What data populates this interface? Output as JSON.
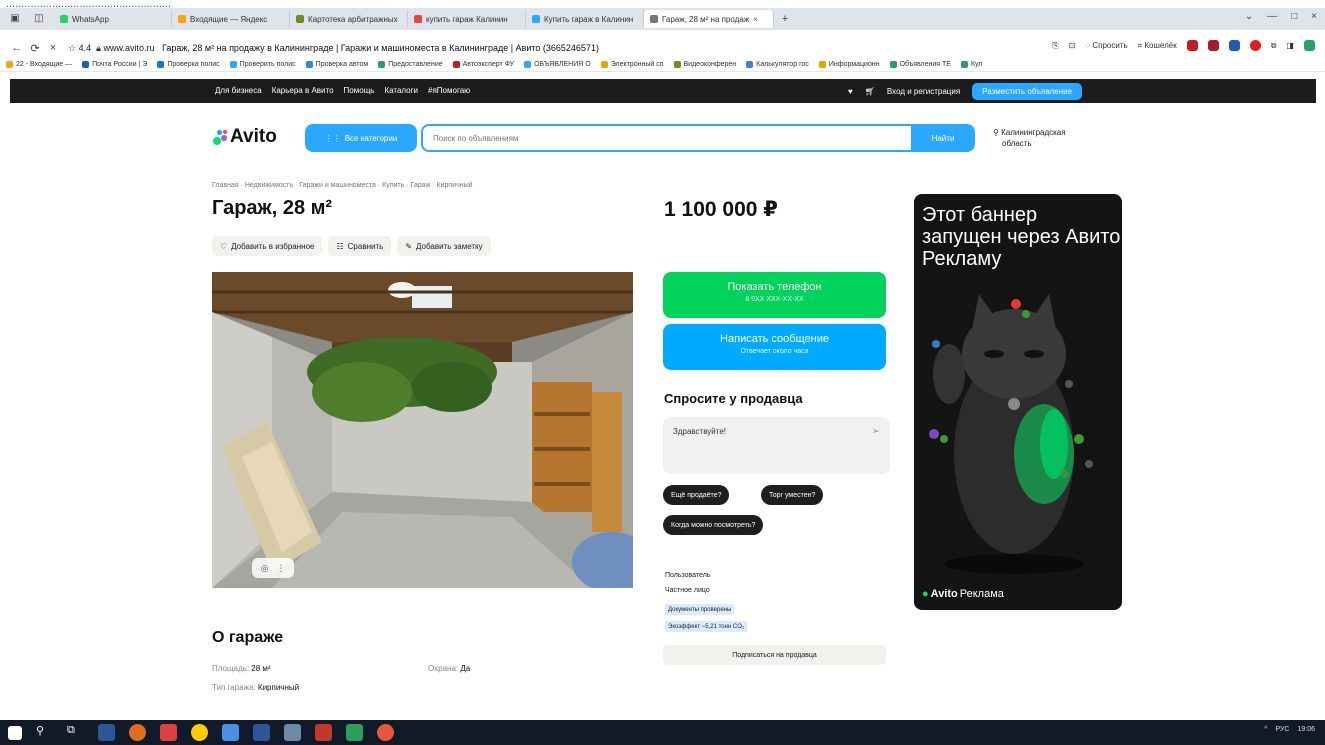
{
  "top_link": "......................................................",
  "browser": {
    "tabs": [
      {
        "label": "WhatsApp",
        "color": "#25d366",
        "active": false
      },
      {
        "label": "Входящие — Яндекс",
        "color": "#f7a21b",
        "active": false
      },
      {
        "label": "Картотека арбитражных",
        "color": "#6b8e23",
        "active": false
      },
      {
        "label": "купить гараж Калинин",
        "color": "#e24a3b",
        "active": false
      },
      {
        "label": "Купить гараж в Калинин",
        "color": "#2aa8ff",
        "active": false
      },
      {
        "label": "Гараж, 28 м² на продаж",
        "color": "#777777",
        "active": true
      }
    ],
    "tab_close": "×",
    "new_tab": "+",
    "window_controls": [
      "⌄",
      "—",
      "□",
      "×"
    ],
    "address": {
      "rating": "4.4",
      "domain": "www.avito.ru",
      "page_title": "Гараж, 28 м² на продажу в Калининграде | Гаражи и машиноместа в Калининграде | Авито (3665246571)"
    },
    "addr_right": {
      "ask": "Спросить",
      "koshelek": "Кошелёк"
    },
    "bookmarks": [
      {
        "label": "22 - Входящие —",
        "color": "#f7a21b"
      },
      {
        "label": "Почта России | Э",
        "color": "#1a5fb4"
      },
      {
        "label": "Проверка полис",
        "color": "#1c71d8"
      },
      {
        "label": "Проверить полис",
        "color": "#2aa8ff"
      },
      {
        "label": "Проверка автом",
        "color": "#3584e4"
      },
      {
        "label": "Предоставление",
        "color": "#26a269"
      },
      {
        "label": "Автоэксперт ФУ",
        "color": "#c01c28"
      },
      {
        "label": "ОБЪЯВЛЕНИЯ О",
        "color": "#2aa8ff"
      },
      {
        "label": "Электронный сп",
        "color": "#e5a50a"
      },
      {
        "label": "Видеоконферен",
        "color": "#6b8e23"
      },
      {
        "label": "Калькулятор гос",
        "color": "#3584e4"
      },
      {
        "label": "Информационн",
        "color": "#e5a50a"
      },
      {
        "label": "Объявления ТЕ",
        "color": "#26a269"
      },
      {
        "label": "Кул",
        "color": "#26a269"
      }
    ]
  },
  "avito_top": {
    "links": [
      "Для бизнеса",
      "Карьера в Авито",
      "Помощь",
      "Каталоги",
      "#яПомогаю"
    ],
    "login": "Вход и регистрация",
    "post_ad": "Разместить объявление"
  },
  "search": {
    "logo": "Avito",
    "categories_label": "Все категории",
    "placeholder": "Поиск по объявлениям",
    "find_label": "Найти",
    "region_l1": "Калининградская",
    "region_l2": "область"
  },
  "listing": {
    "breadcrumbs": "Главная · Недвижимость · Гаражи и машиноместа · Купить · Гараж · Кирпичный",
    "title": "Гараж, 28 м²",
    "actions": {
      "favorite": "Добавить в избранное",
      "compare": "Сравнить",
      "note": "Добавить заметку"
    },
    "price": "1 100 000 ₽",
    "about_title": "О гараже",
    "params": [
      {
        "label": "Площадь:",
        "value": "28 м²"
      },
      {
        "label": "Охрана:",
        "value": "Да"
      },
      {
        "label": "Тип гаража:",
        "value": "Кирпичный"
      }
    ]
  },
  "contact": {
    "phone_title": "Показать телефон",
    "phone_sub": "8 9XX XXX-XX-XX",
    "message_title": "Написать сообщение",
    "message_sub": "Отвечает около часа",
    "ask_title": "Спросите у продавца",
    "ask_text": "Здравствуйте!",
    "chips": [
      "Ещё продаёте?",
      "Торг уместен?",
      "Когда можно посмотреть?"
    ],
    "seller_role": "Пользователь",
    "seller_type": "Частное лицо",
    "docs_badge": "Документы проверены",
    "eco_badge": "Экоэффект −5,21 тонн CO₂",
    "subscribe": "Подписаться на продавца"
  },
  "banner": {
    "text": "Этот баннер запущен через Авито Рекламу",
    "brand": "Avito",
    "brand_suffix": "Реклама"
  },
  "taskbar": {
    "tray": [
      "^",
      "РУС",
      "19:06"
    ]
  }
}
